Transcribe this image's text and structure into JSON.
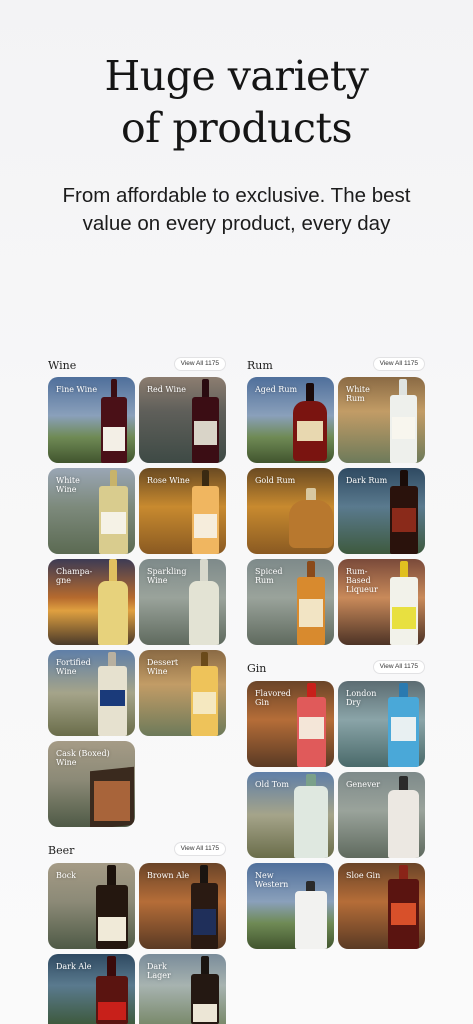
{
  "hero": {
    "title_line1": "Huge variety",
    "title_line2": "of products",
    "subtitle_line1": "From affordable to exclusive. The best",
    "subtitle_line2": "value on every product, every day"
  },
  "sections": {
    "wine": {
      "title": "Wine",
      "view_all": "View All 1175",
      "items": [
        "Fine Wine",
        "Red Wine",
        "White Wine",
        "Rose Wine",
        "Champa-gne",
        "Sparkling Wine",
        "Fortified Wine",
        "Dessert Wine",
        "Cask (Boxed) Wine"
      ]
    },
    "beer": {
      "title": "Beer",
      "view_all": "View All 1175",
      "items": [
        "Bock",
        "Brown Ale",
        "Dark Ale",
        "Dark Lager"
      ]
    },
    "rum": {
      "title": "Rum",
      "view_all": "View All 1175",
      "items": [
        "Aged Rum",
        "White Rum",
        "Gold Rum",
        "Dark Rum",
        "Spiced Rum",
        "Rum-Based Liqueur"
      ]
    },
    "gin": {
      "title": "Gin",
      "view_all": "View All 1175",
      "items": [
        "Flavored Gin",
        "London Dry",
        "Old Tom",
        "Genever",
        "New Western",
        "Sloe Gin"
      ]
    }
  },
  "colors": {
    "background": "#f5f5f6",
    "card_label": "#ffffff",
    "pill_background": "#ffffff"
  }
}
